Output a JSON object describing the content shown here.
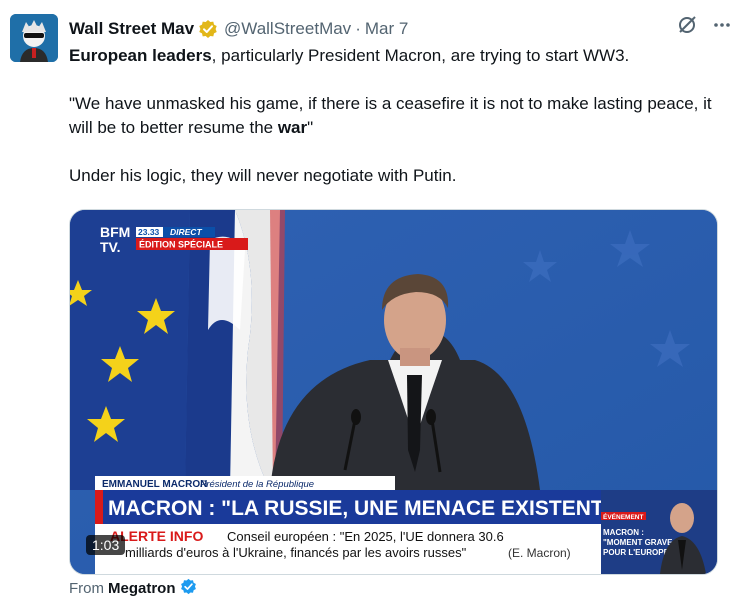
{
  "author": {
    "name": "Wall Street Mav",
    "handle": "@WallStreetMav",
    "separator": "·",
    "date": "Mar 7"
  },
  "tweet": {
    "line1_bold": "European leaders",
    "line1_rest": ", particularly President Macron, are trying to start WW3.",
    "quote_part1": "\"We have unmasked his game, if there is a ceasefire it is not to make lasting peace, it will be to better resume the ",
    "quote_bold": "war",
    "quote_end": "\"",
    "line3": "Under his logic, they will never negotiate with Putin."
  },
  "video": {
    "logo_top": "BFM",
    "logo_bottom": "TV.",
    "time": "23.33",
    "live": "DIRECT",
    "edition": "ÉDITION SPÉCIALE",
    "speaker_name": "EMMANUEL MACRON",
    "speaker_title": "Président de la République",
    "headline": "MACRON : \"LA RUSSIE, UNE MENACE EXISTENTIELLE\"",
    "alert_label": "ALERTE INFO",
    "ticker_line1": "Conseil européen : \"En 2025, l'UE donnera 30.6",
    "ticker_line2": "milliards d'euros à l'Ukraine, financés par les avoirs russes\"",
    "ticker_source": "(E. Macron)",
    "side_badge": "ÉVÉNEMENT",
    "side_title1": "MACRON :",
    "side_title2": "\"MOMENT GRAVE",
    "side_title3": "POUR L'EUROPE\"",
    "duration": "1:03"
  },
  "footer": {
    "from_label": "From",
    "from_name": "Megatron"
  },
  "colors": {
    "verified_gold": "#e2b719",
    "verified_blue": "#1d9bf0",
    "headline_red": "#d91a1a",
    "bfm_blue": "#0b4fa8"
  },
  "icons": {
    "grok": "slash-circle-icon",
    "more": "more-icon"
  }
}
